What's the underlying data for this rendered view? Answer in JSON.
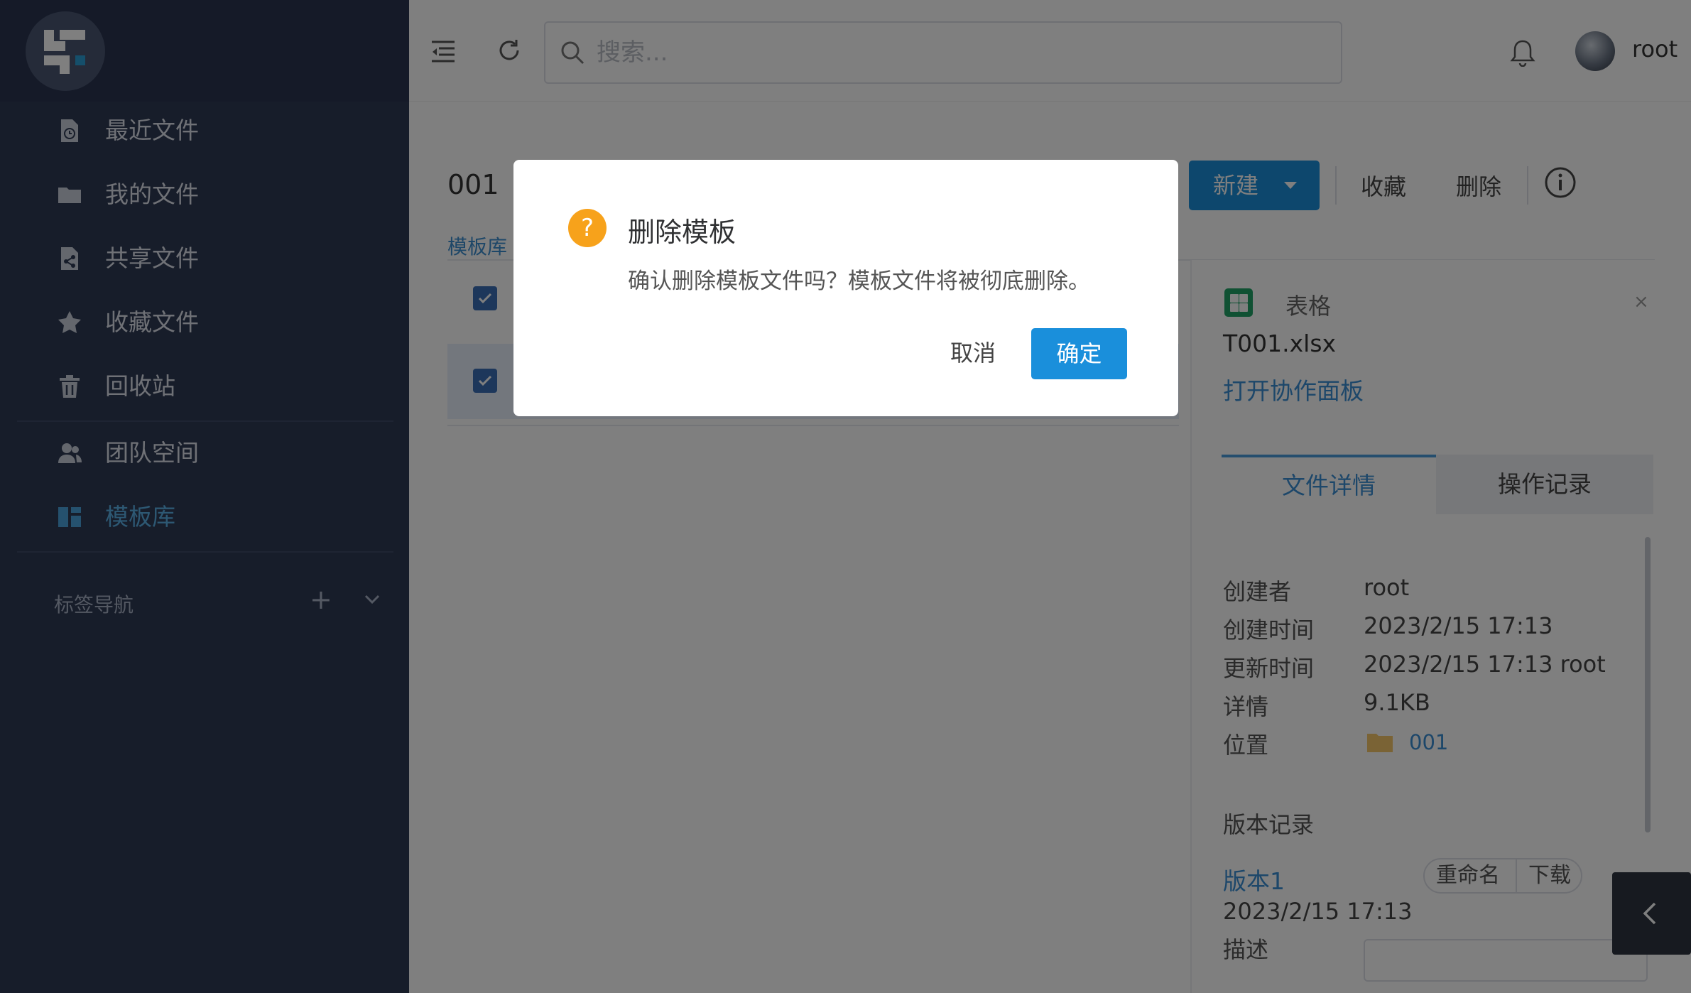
{
  "sidebar": {
    "items": [
      {
        "label": "最近文件",
        "icon": "recent-file-icon"
      },
      {
        "label": "我的文件",
        "icon": "folder-icon"
      },
      {
        "label": "共享文件",
        "icon": "share-file-icon"
      },
      {
        "label": "收藏文件",
        "icon": "star-icon"
      },
      {
        "label": "回收站",
        "icon": "trash-icon"
      },
      {
        "label": "团队空间",
        "icon": "team-icon"
      },
      {
        "label": "模板库",
        "icon": "template-icon",
        "active": true
      }
    ],
    "tag_nav_label": "标签导航",
    "tag_add": "+"
  },
  "topbar": {
    "search_placeholder": "搜索...",
    "username": "root"
  },
  "main": {
    "title": "001",
    "breadcrumb": "模板库",
    "toolbar": {
      "new_label": "新建",
      "favorite_label": "收藏",
      "delete_label": "删除"
    }
  },
  "panel": {
    "file_type": "表格",
    "file_name": "T001.xlsx",
    "open_collab": "打开协作面板",
    "close": "×",
    "tabs": [
      "文件详情",
      "操作记录"
    ],
    "details": [
      {
        "key": "创建者",
        "value": "root"
      },
      {
        "key": "创建时间",
        "value": "2023/2/15 17:13"
      },
      {
        "key": "更新时间",
        "value": "2023/2/15 17:13 root"
      },
      {
        "key": "详情",
        "value": "9.1KB"
      },
      {
        "key": "位置",
        "value": "001"
      }
    ],
    "version_title": "版本记录",
    "version": {
      "name": "版本1",
      "date": "2023/2/15 17:13",
      "desc_label": "描述",
      "rename": "重命名",
      "download": "下载"
    }
  },
  "dialog": {
    "title": "删除模板",
    "message": "确认删除模板文件吗？模板文件将被彻底删除。",
    "cancel": "取消",
    "confirm": "确定",
    "icon_char": "?"
  },
  "colors": {
    "sidebar_bg": "#2f3a55",
    "accent": "#1a8fdb",
    "warning": "#f7a21b"
  }
}
